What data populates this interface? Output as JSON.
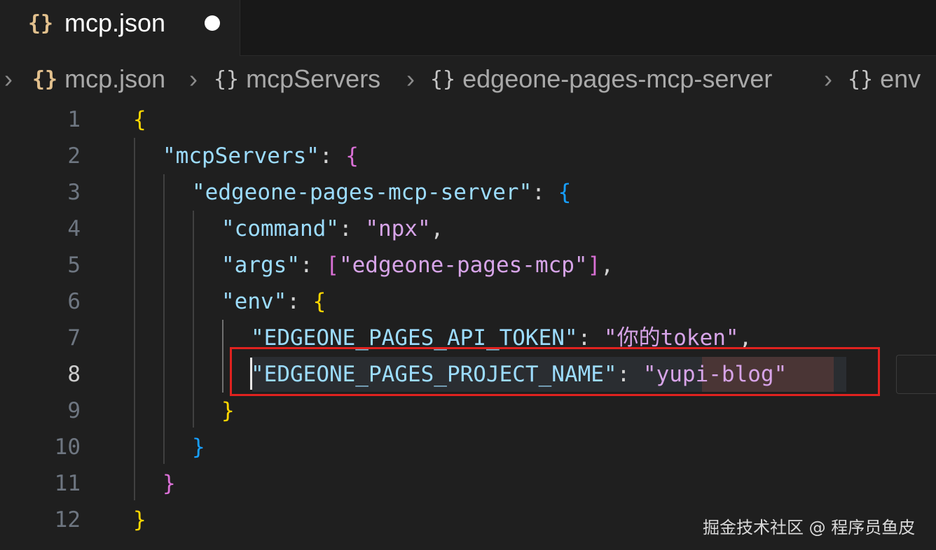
{
  "tab": {
    "icon": "json-braces-icon",
    "braces": "{}",
    "title": "mcp.json",
    "unsaved": true
  },
  "breadcrumb": {
    "file": "mcp.json",
    "object_braces": "{}",
    "items": [
      "mcpServers",
      "edgeone-pages-mcp-server",
      "env"
    ]
  },
  "editor": {
    "line_numbers": [
      "1",
      "2",
      "3",
      "4",
      "5",
      "6",
      "7",
      "8",
      "9",
      "10",
      "11",
      "12"
    ],
    "active_line": "8",
    "lines": {
      "l1": {
        "open": "{"
      },
      "l2": {
        "key": "\"mcpServers\"",
        "colon": ": ",
        "open": "{"
      },
      "l3": {
        "key": "\"edgeone-pages-mcp-server\"",
        "colon": ": ",
        "open": "{"
      },
      "l4": {
        "key": "\"command\"",
        "colon": ": ",
        "value": "\"npx\"",
        "comma": ","
      },
      "l5": {
        "key": "\"args\"",
        "colon": ": ",
        "bracket_open": "[",
        "value": "\"edgeone-pages-mcp\"",
        "bracket_close": "]",
        "comma": ","
      },
      "l6": {
        "key": "\"env\"",
        "colon": ": ",
        "open": "{"
      },
      "l7": {
        "key": "\"EDGEONE_PAGES_API_TOKEN\"",
        "colon": ": ",
        "value": "\"你的token\"",
        "comma": ","
      },
      "l8": {
        "key": "\"EDGEONE_PAGES_PROJECT_NAME\"",
        "colon": ": ",
        "quote_open": "\"",
        "value": "yupi-blog",
        "quote_close": "\""
      },
      "l9": {
        "close": "}"
      },
      "l10": {
        "close": "}"
      },
      "l11": {
        "close": "}"
      },
      "l12": {
        "close": "}"
      }
    }
  },
  "colors": {
    "highlight_box": "#e0221f",
    "json_key": "#9cdcfe",
    "json_string": "#d7a4e8"
  },
  "watermark": "掘金技术社区 @ 程序员鱼皮"
}
